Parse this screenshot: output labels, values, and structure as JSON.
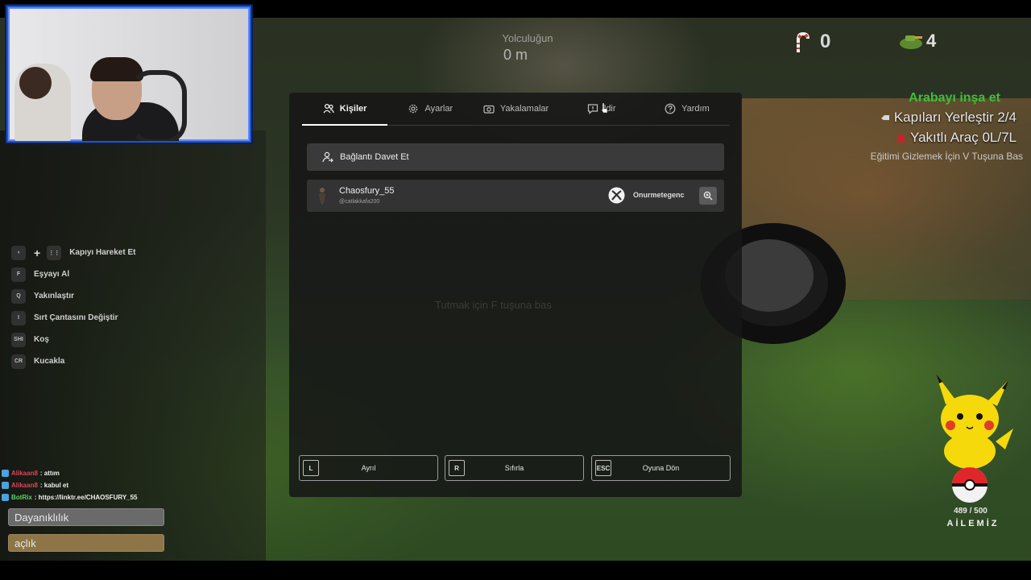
{
  "hud": {
    "distance_label": "Yolculuğun",
    "distance_value": "0 m",
    "candy_count": "0",
    "tank_count": "4"
  },
  "objectives": {
    "title": "Arabayı inşa et",
    "item1": "Kapıları Yerleştir 2/4",
    "item2": "Yakıtlı Araç 0L/7L",
    "hint": "Eğitimi Gizlemek İçin V Tuşuna Bas"
  },
  "controls": [
    {
      "key": "",
      "label": "Kapıyı Hareket Et"
    },
    {
      "key": "F",
      "label": "Eşyayı Al"
    },
    {
      "key": "Q",
      "label": "Yakınlaştır"
    },
    {
      "key": "I",
      "label": "Sırt Çantasını Değiştir"
    },
    {
      "key": "SHI",
      "label": "Koş"
    },
    {
      "key": "CR",
      "label": "Kucakla"
    }
  ],
  "chat": [
    {
      "user": "Alikaan8",
      "msg": ": attım"
    },
    {
      "user": "Alikaan8",
      "msg": ": kabul et"
    },
    {
      "user": "BotRix",
      "msg": ": https://linktr.ee/CHAOSFURY_55"
    }
  ],
  "stats": {
    "durability": "Dayanıklılık",
    "hunger": "açlık"
  },
  "overlay": {
    "count": "489 / 500",
    "family": "AİLEMİZ"
  },
  "menu": {
    "tabs": [
      {
        "label": "Kişiler"
      },
      {
        "label": "Ayarlar"
      },
      {
        "label": "Yakalamalar"
      },
      {
        "label": "ldir"
      },
      {
        "label": "Yardım"
      }
    ],
    "invite_label": "Bağlantı Davet Et",
    "player": {
      "name": "Chaosfury_55",
      "handle": "@catlakkafa200",
      "gamertag": "Onurmetegenc"
    },
    "faded_hint": "Tutmak için F tuşuna bas",
    "footer": [
      {
        "key": "L",
        "label": "Ayrıl"
      },
      {
        "key": "R",
        "label": "Sıfırla"
      },
      {
        "key": "ESC",
        "label": "Oyuna Dön"
      }
    ]
  },
  "colors": {
    "objective_title": "#3bbf3b",
    "webcam_border": "#1e55c8",
    "menu_bg": "#161616"
  }
}
